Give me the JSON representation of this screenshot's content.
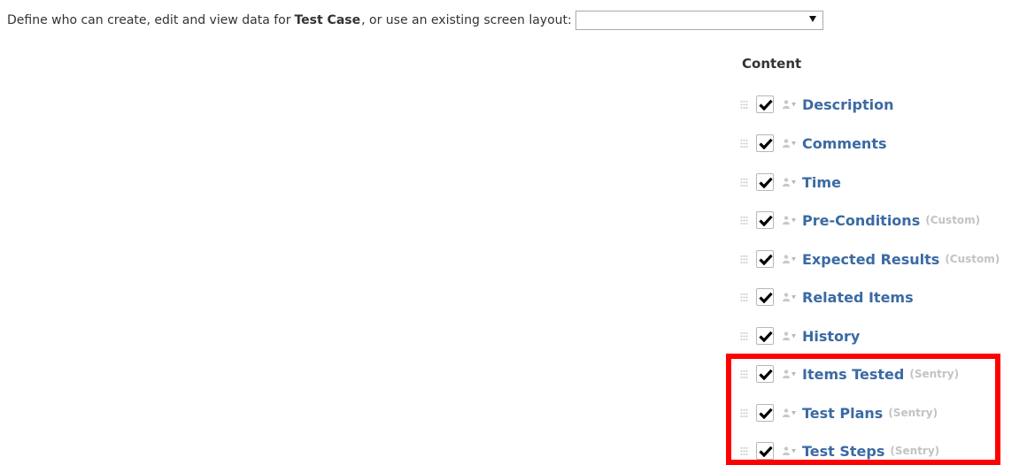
{
  "header": {
    "prefix": "Define who can create, edit and view data for",
    "object_name": "Test Case",
    "suffix": ", or use an existing screen layout:",
    "layout_select_value": ""
  },
  "content": {
    "heading": "Content",
    "fields": [
      {
        "label": "Description",
        "tag": "",
        "checked": true
      },
      {
        "label": "Comments",
        "tag": "",
        "checked": true
      },
      {
        "label": "Time",
        "tag": "",
        "checked": true
      },
      {
        "label": "Pre-Conditions",
        "tag": "(Custom)",
        "checked": true
      },
      {
        "label": "Expected Results",
        "tag": "(Custom)",
        "checked": true
      },
      {
        "label": "Related Items",
        "tag": "",
        "checked": true
      },
      {
        "label": "History",
        "tag": "",
        "checked": true
      },
      {
        "label": "Items Tested",
        "tag": "(Sentry)",
        "checked": true
      },
      {
        "label": "Test Plans",
        "tag": "(Sentry)",
        "checked": true
      },
      {
        "label": "Test Steps",
        "tag": "(Sentry)",
        "checked": true
      }
    ]
  },
  "icons": {
    "grip": "drag-handle-icon",
    "checkbox": "checkmark-icon",
    "permissions": "user-permission-icon",
    "dropdown": "dropdown-arrow-icon"
  },
  "colors": {
    "field_label": "#3b6aa3",
    "tag": "#c3c3c3",
    "highlight": "#ff0000"
  }
}
